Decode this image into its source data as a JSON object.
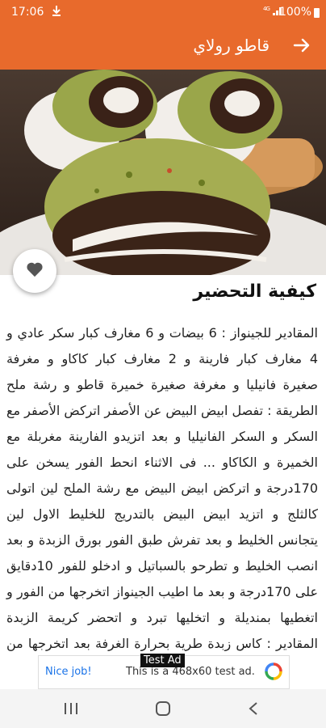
{
  "status_bar": {
    "time": "17:06",
    "battery": "100%",
    "signal": "4G",
    "icons": [
      "download-icon",
      "signal-icon",
      "battery-icon"
    ]
  },
  "app_bar": {
    "title": "قاطو رولاي",
    "back_icon": "arrow-right-icon"
  },
  "recipe": {
    "favorite_icon": "heart-icon",
    "heading": "كيفية التحضير",
    "body": "المقادير للجينواز : 6 بيضات و 6 مغارف كبار سكر عادي و 4 مغارف كبار فارينة و 2 مغارف كبار كاكاو و مغرفة صغيرة فانيليا و مغرفة صغيرة خميرة قاطو و رشة ملح الطريقة : تفصل ابيض البيض عن الأصفر اتركض الأصفر مع السكر و السكر الفانيليا و بعد اتزيدو الفارينة مغربلة مع الخميرة و الكاكاو ... فى الاثناء انحط الفور يسخن على 170درجة و اتركض ابيض البيض مع رشة الملح لين اتولى كالثلج و اتزيد ابيض البيض بالتدريج للخليط الاول لين يتجانس الخليط و بعد تفرش طبق الفور بورق الزبدة و بعد انصب الخليط و تطرحو بالسباتيل و ادخلو للفور 10دقايق على 170درجة و بعد ما اطيب الجينواز اتخرجها من الفور و اتغطيها بمنديلة و اتخليها تبرد و اتحضر كريمة الزبدة المقادير : كاس زبدة طرية بحرارة الغرفة بعد اتخرجها من الفريجيدير قبل"
  },
  "ad": {
    "label": "Test Ad",
    "nice": "Nice job!",
    "message": "This is a 468x60 test ad."
  },
  "nav_bar": {
    "buttons": [
      "recents-icon",
      "home-icon",
      "back-icon"
    ]
  }
}
